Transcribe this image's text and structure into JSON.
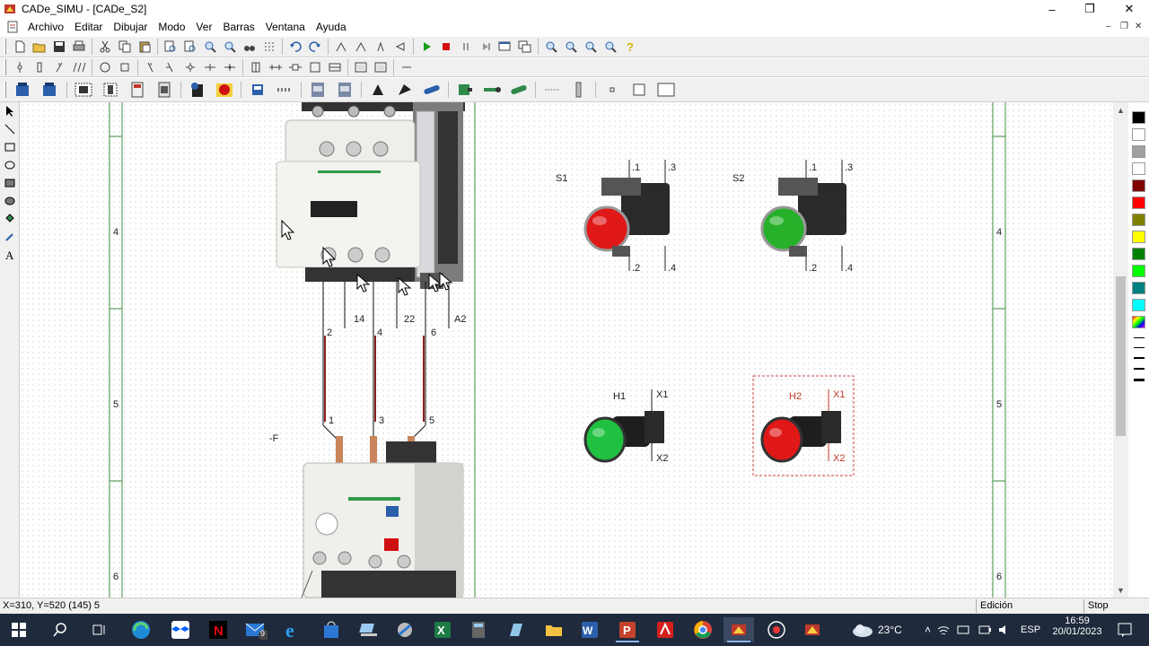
{
  "window": {
    "title": "CADe_SIMU - [CADe_S2]",
    "controls": [
      "–",
      "❐",
      "✕"
    ]
  },
  "menu": [
    "Archivo",
    "Editar",
    "Dibujar",
    "Modo",
    "Ver",
    "Barras",
    "Ventana",
    "Ayuda"
  ],
  "canvas": {
    "row_numbers": [
      "4",
      "5",
      "6"
    ],
    "contactor_labels": [
      "2",
      "14",
      "4",
      "22",
      "6",
      "A2"
    ],
    "relay_labels": [
      "1",
      "3",
      "5"
    ],
    "relay_tag": "-F",
    "pushbuttons": [
      {
        "tag": "S1",
        "t1": ".1",
        "t3": ".3",
        "t2": ".2",
        "t4": ".4",
        "color": "#e01818"
      },
      {
        "tag": "S2",
        "t1": ".1",
        "t3": ".3",
        "t2": ".2",
        "t4": ".4",
        "color": "#27b12b"
      }
    ],
    "lamps": [
      {
        "tag": "H1",
        "x1": "X1",
        "x2": "X2",
        "color": "#20c040"
      },
      {
        "tag": "H2",
        "x1": "X1",
        "x2": "X2",
        "color": "#e01818"
      }
    ]
  },
  "status": {
    "coords": "X=310, Y=520 (145) 5",
    "mode": "Edición",
    "state": "Stop"
  },
  "taskbar": {
    "mail_badge": "9",
    "weather": "23°C",
    "lang": "ESP",
    "time": "16:59",
    "date": "20/01/2023"
  },
  "colors": [
    "#000000",
    "#ffffff",
    "#a0a0a0",
    "#ffffff",
    "#800000",
    "#ff0000",
    "#808000",
    "#ffff00",
    "#008000",
    "#00ff00",
    "#008080",
    "#00ffff"
  ]
}
